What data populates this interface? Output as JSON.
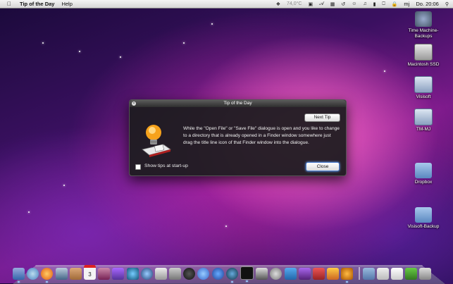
{
  "menubar": {
    "app_name": "Tip of the Day",
    "help": "Help",
    "temperature": "74,0°C",
    "user": "mj",
    "clock": "Do. 20:06"
  },
  "desktop_icons": [
    {
      "label": "Time Machine-Backups"
    },
    {
      "label": "Macintosh SSD"
    },
    {
      "label": "Visisoft"
    },
    {
      "label": "TM-MJ"
    },
    {
      "label": "Dropbox"
    },
    {
      "label": "Visisoft-Backup"
    }
  ],
  "dialog": {
    "title": "Tip of the Day",
    "next_tip": "Next Tip",
    "tip_text": "While the \"Open File\" or \"Save File\" dialogue is open and you like to change to a directory that is already opened in a Finder window somewhere just drag the title line icon of that Finder window into the dialogue.",
    "show_tips_label": "Show tips at start-up",
    "close": "Close"
  },
  "dock": {
    "calendar_day": "3"
  },
  "colors": {
    "accent": "#4d7fd0",
    "dialog_bg": "#1c1c1e"
  }
}
